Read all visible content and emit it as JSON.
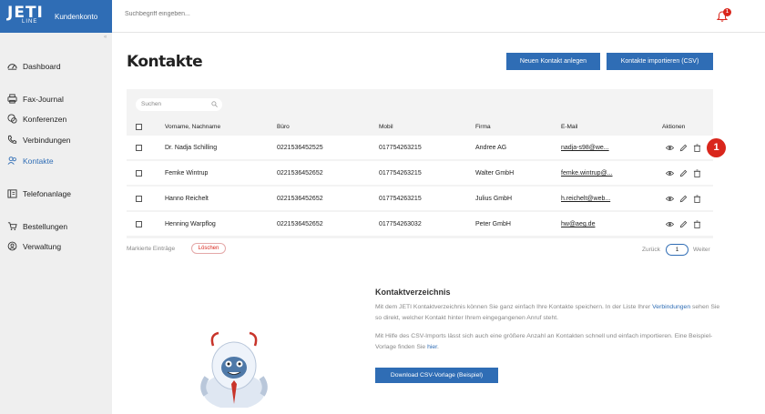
{
  "header": {
    "logo": "JETI",
    "logo_sub": "LINE",
    "app_label": "Kundenkonto",
    "search_placeholder": "Suchbegriff eingeben...",
    "notification_count": "1"
  },
  "sidebar": {
    "collapse": "«",
    "items": [
      {
        "label": "Dashboard",
        "icon": "dashboard-icon"
      },
      {
        "label": "Fax-Journal",
        "icon": "fax-icon"
      },
      {
        "label": "Konferenzen",
        "icon": "conference-icon"
      },
      {
        "label": "Verbindungen",
        "icon": "phone-icon"
      },
      {
        "label": "Kontakte",
        "icon": "contacts-icon",
        "active": true
      },
      {
        "label": "Telefonanlage",
        "icon": "phone-system-icon"
      },
      {
        "label": "Bestellungen",
        "icon": "cart-icon"
      },
      {
        "label": "Verwaltung",
        "icon": "settings-icon"
      }
    ]
  },
  "main": {
    "title": "Kontakte",
    "new_contact_label": "Neuen Kontakt anlegen",
    "import_label": "Kontakte importieren (CSV)",
    "table_search_placeholder": "Suchen",
    "columns": [
      "Vorname, Nachname",
      "Büro",
      "Mobil",
      "Firma",
      "E-Mail",
      "Aktionen"
    ],
    "rows": [
      {
        "name": "Dr. Nadja Schilling",
        "office": "0221536452525",
        "mobile": "017754263215",
        "company": "Andree AG",
        "email": "nadja-s98@we..."
      },
      {
        "name": "Femke Wintrup",
        "office": "0221536452652",
        "mobile": "017754263215",
        "company": "Walter GmbH",
        "email": "femke.wintrup@..."
      },
      {
        "name": "Hanno Reichelt",
        "office": "0221536452652",
        "mobile": "017754263215",
        "company": "Julius GmbH",
        "email": "h.reichelt@web..."
      },
      {
        "name": "Henning Warpflog",
        "office": "0221536452652",
        "mobile": "017754263032",
        "company": "Peter GmbH",
        "email": "hw@aeg.de"
      }
    ],
    "marked_label": "Markierte Einträge",
    "delete_label": "Löschen",
    "pager_back": "Zurück",
    "pager_page": "1",
    "pager_next": "Weiter",
    "callout": "1"
  },
  "info": {
    "title": "Kontaktverzeichnis",
    "p1_a": "Mit dem JETI Kontaktverzeichnis können Sie ganz einfach Ihre Kontakte speichern. In der Liste Ihrer",
    "p1_link": "Verbindungen",
    "p1_b": " sehen Sie so direkt, welcher Kontakt hinter Ihrem eingegangenen Anruf steht.",
    "p2_a": "Mit Hilfe des CSV-Imports lässt sich auch eine größere Anzahl an Kontakten schnell und einfach importieren.",
    "p2_b": "Eine Beispiel-Vorlage finden Sie ",
    "p2_link": "hier",
    "p2_c": ".",
    "download_label": "Download CSV-Vorlage (Beispiel)"
  },
  "colors": {
    "accent": "#2f6db5",
    "alert": "#d9261c",
    "sidebar_bg": "#efefef"
  }
}
